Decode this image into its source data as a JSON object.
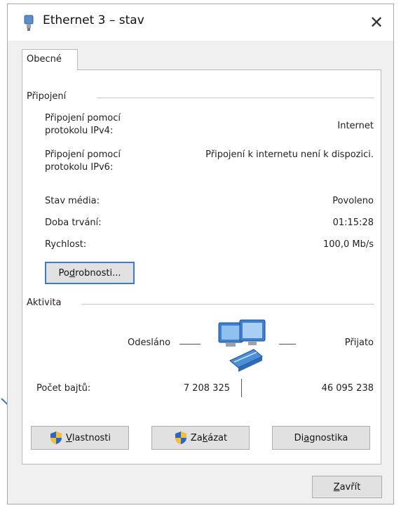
{
  "window": {
    "title": "Ethernet 3 – stav",
    "close_glyph": "✕"
  },
  "tab": {
    "label": "Obecné"
  },
  "connection": {
    "group_label": "Připojení",
    "ipv4_label_line1": "Připojení pomocí",
    "ipv4_label_line2": "protokolu IPv4:",
    "ipv4_value": "Internet",
    "ipv6_label_line1": "Připojení pomocí",
    "ipv6_label_line2": "protokolu IPv6:",
    "ipv6_value": "Připojení k internetu není k dispozici.",
    "media_label": "Stav média:",
    "media_value": "Povoleno",
    "duration_label": "Doba trvání:",
    "duration_value": "01:15:28",
    "speed_label": "Rychlost:",
    "speed_value": "100,0 Mb/s",
    "details_button_pre": "Po",
    "details_button_ul": "d",
    "details_button_post": "robnosti..."
  },
  "activity": {
    "group_label": "Aktivita",
    "sent_label": "Odesláno",
    "received_label": "Přijato",
    "bytes_label": "Počet bajtů:",
    "bytes_sent": "7 208 325",
    "bytes_received": "46 095 238"
  },
  "buttons": {
    "properties_ul": "V",
    "properties_rest": "lastnosti",
    "disable_pre": "Za",
    "disable_ul": "k",
    "disable_post": "ázat",
    "diagnose_pre": "Di",
    "diagnose_ul": "a",
    "diagnose_post": "gnostika",
    "close_pre": "",
    "close_ul": "Z",
    "close_post": "avřít"
  },
  "colors": {
    "accent": "#3b7bd6",
    "arrow": "#3a78c8",
    "shield_blue": "#2a66c9",
    "shield_yellow": "#f2c230"
  },
  "icons": {
    "title": "network-adapter-icon",
    "activity": "networked-computers-icon",
    "shield": "uac-shield-icon"
  }
}
